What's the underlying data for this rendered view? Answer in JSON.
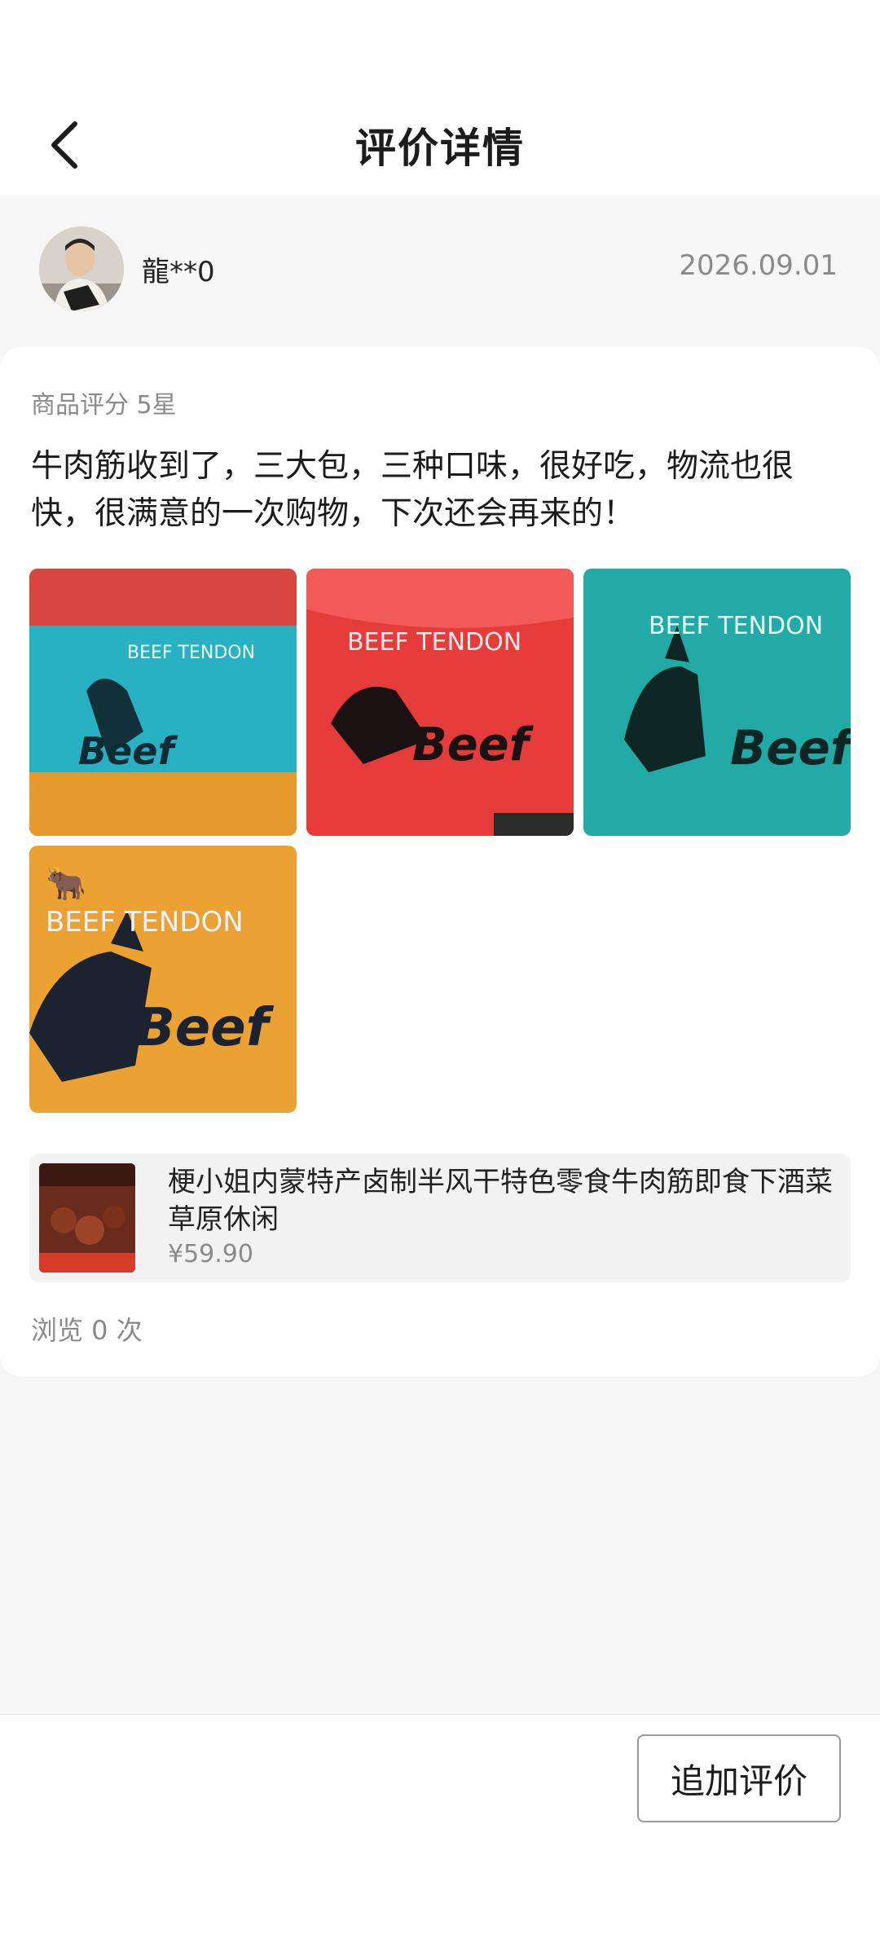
{
  "header": {
    "title": "评价详情",
    "back_icon": "chevron-left-icon"
  },
  "review": {
    "username": "龍**0",
    "date": "2026.09.01",
    "rating_text": "商品评分 5星",
    "text": "牛肉筋收到了，三大包，三种口味，很好吃，物流也很快，很满意的一次购物，下次还会再来的！",
    "photos": [
      {
        "color": "#27b1c2",
        "label_top": "BEEF TENDON",
        "label_bottom": "Beef"
      },
      {
        "color": "#e63b3b",
        "label_top": "BEEF TENDON",
        "label_bottom": "Beef"
      },
      {
        "color": "#22aaa6",
        "label_top": "BEEF TENDON",
        "label_bottom": "Beef"
      },
      {
        "color": "#eba232",
        "label_top": "BEEF TENDON",
        "label_bottom": "Beef"
      }
    ],
    "views_text": "浏览 0 次"
  },
  "product": {
    "name": "梗小姐内蒙特产卤制半风干特色零食牛肉筋即食下酒菜草原休闲",
    "price": "¥59.90"
  },
  "footer": {
    "add_review_label": "追加评价"
  },
  "colors": {
    "page_bg": "#f6f6f6",
    "card_bg": "#ffffff",
    "muted_text": "#8a8a8a"
  }
}
